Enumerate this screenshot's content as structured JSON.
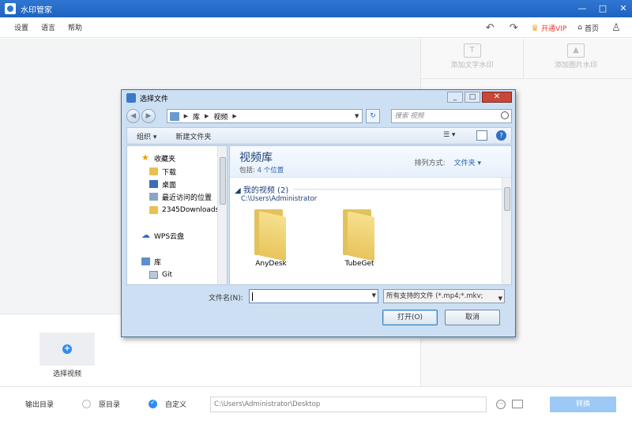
{
  "app": {
    "title": "水印管家"
  },
  "menu": {
    "settings": "设置",
    "language": "语言",
    "help": "帮助"
  },
  "header": {
    "vip_label": "开通VIP",
    "home_label": "首页"
  },
  "right_panel": {
    "tab_text": "添加文字水印",
    "tab_image": "添加图片水印"
  },
  "main": {
    "add_video_label": "选择视频"
  },
  "footer": {
    "output_label": "输出目录",
    "option_original": "原目录",
    "option_custom": "自定义",
    "path_value": "C:\\Users\\Administrator\\Desktop",
    "convert_label": "转换"
  },
  "dialog": {
    "title": "选择文件",
    "breadcrumb": [
      "库",
      "视频"
    ],
    "search_placeholder": "搜索 视频",
    "organize": "组织",
    "new_folder": "新建文件夹",
    "nav_items": [
      "收藏夹",
      "下载",
      "桌面",
      "最近访问的位置",
      "2345Downloads",
      "WPS云盘",
      "库",
      "Git"
    ],
    "library_title": "视频库",
    "includes_label": "包括:",
    "includes_link": "4 个位置",
    "sort_label": "排列方式:",
    "sort_value": "文件夹",
    "group_header": "我的视频 (2)",
    "group_path": "C:\\Users\\Administrator",
    "folders": [
      "AnyDesk",
      "TubeGet"
    ],
    "filename_label": "文件名(N):",
    "filename_value": "",
    "filetype_value": "所有支持的文件 (*.mp4;*.mkv;",
    "open_button": "打开(O)",
    "cancel_button": "取消"
  },
  "colors": {
    "title_bar": "#2f76d2",
    "accent": "#2f8cf2",
    "vip": "#e33333"
  }
}
